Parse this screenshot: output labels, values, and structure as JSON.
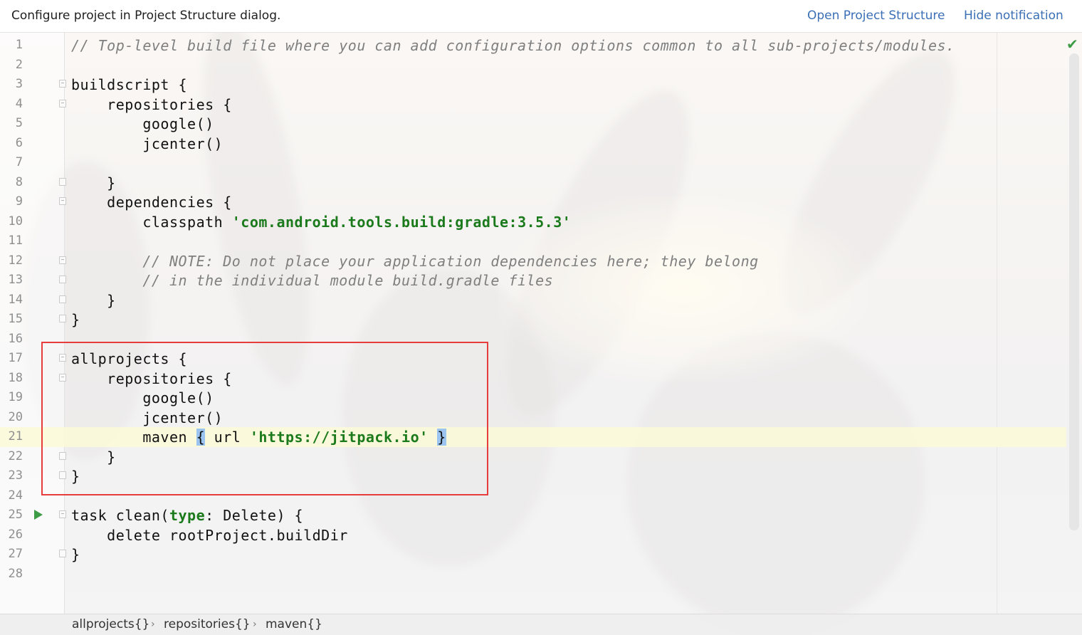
{
  "notification": {
    "message": "Configure project in Project Structure dialog.",
    "open_link": "Open Project Structure",
    "hide_link": "Hide notification"
  },
  "editor": {
    "current_line": 21,
    "lines": [
      {
        "n": "1",
        "segs": [
          {
            "t": "// Top-level build file where you can add configuration options common to all sub-projects/modules.",
            "c": "cmt"
          }
        ]
      },
      {
        "n": "2",
        "segs": []
      },
      {
        "n": "3",
        "segs": [
          {
            "t": "buildscript {",
            "c": ""
          }
        ],
        "fold": "open"
      },
      {
        "n": "4",
        "segs": [
          {
            "t": "    repositories {",
            "c": ""
          }
        ],
        "fold": "open"
      },
      {
        "n": "5",
        "segs": [
          {
            "t": "        google()",
            "c": ""
          }
        ]
      },
      {
        "n": "6",
        "segs": [
          {
            "t": "        jcenter()",
            "c": ""
          }
        ]
      },
      {
        "n": "7",
        "segs": []
      },
      {
        "n": "8",
        "segs": [
          {
            "t": "    }",
            "c": ""
          }
        ],
        "fold": "close"
      },
      {
        "n": "9",
        "segs": [
          {
            "t": "    dependencies {",
            "c": ""
          }
        ],
        "fold": "open"
      },
      {
        "n": "10",
        "segs": [
          {
            "t": "        classpath ",
            "c": ""
          },
          {
            "t": "'com.android.tools.build:gradle:3.5.3'",
            "c": "str"
          }
        ]
      },
      {
        "n": "11",
        "segs": []
      },
      {
        "n": "12",
        "segs": [
          {
            "t": "        // NOTE: Do not place your application dependencies here; they belong",
            "c": "cmt"
          }
        ],
        "fold": "open"
      },
      {
        "n": "13",
        "segs": [
          {
            "t": "        // in the individual module build.gradle files",
            "c": "cmt"
          }
        ],
        "fold": "close"
      },
      {
        "n": "14",
        "segs": [
          {
            "t": "    }",
            "c": ""
          }
        ],
        "fold": "close"
      },
      {
        "n": "15",
        "segs": [
          {
            "t": "}",
            "c": ""
          }
        ],
        "fold": "close"
      },
      {
        "n": "16",
        "segs": []
      },
      {
        "n": "17",
        "segs": [
          {
            "t": "allprojects {",
            "c": ""
          }
        ],
        "fold": "open"
      },
      {
        "n": "18",
        "segs": [
          {
            "t": "    repositories {",
            "c": ""
          }
        ],
        "fold": "open"
      },
      {
        "n": "19",
        "segs": [
          {
            "t": "        google()",
            "c": ""
          }
        ]
      },
      {
        "n": "20",
        "segs": [
          {
            "t": "        jcenter()",
            "c": ""
          }
        ]
      },
      {
        "n": "21",
        "segs": [
          {
            "t": "        maven ",
            "c": ""
          },
          {
            "t": "{",
            "c": "brm"
          },
          {
            "t": " url ",
            "c": ""
          },
          {
            "t": "'https://jitpack.io'",
            "c": "str"
          },
          {
            "t": " ",
            "c": ""
          },
          {
            "t": "}",
            "c": "brm"
          }
        ]
      },
      {
        "n": "22",
        "segs": [
          {
            "t": "    }",
            "c": ""
          }
        ],
        "fold": "close"
      },
      {
        "n": "23",
        "segs": [
          {
            "t": "}",
            "c": ""
          }
        ],
        "fold": "close"
      },
      {
        "n": "24",
        "segs": []
      },
      {
        "n": "25",
        "segs": [
          {
            "t": "task clean(",
            "c": ""
          },
          {
            "t": "type",
            "c": "kw"
          },
          {
            "t": ": Delete) {",
            "c": ""
          }
        ],
        "fold": "open",
        "run": true
      },
      {
        "n": "26",
        "segs": [
          {
            "t": "    delete rootProject.buildDir",
            "c": ""
          }
        ]
      },
      {
        "n": "27",
        "segs": [
          {
            "t": "}",
            "c": ""
          }
        ],
        "fold": "close"
      },
      {
        "n": "28",
        "segs": []
      }
    ]
  },
  "breadcrumbs": [
    "allprojects{}",
    "repositories{}",
    "maven{}"
  ],
  "status": {
    "inspection_icon": "check-icon"
  },
  "colors": {
    "link": "#3b6fb6",
    "string": "#1b7a1b",
    "comment": "#7f7f7f",
    "highlight_box": "#e63c3c"
  }
}
